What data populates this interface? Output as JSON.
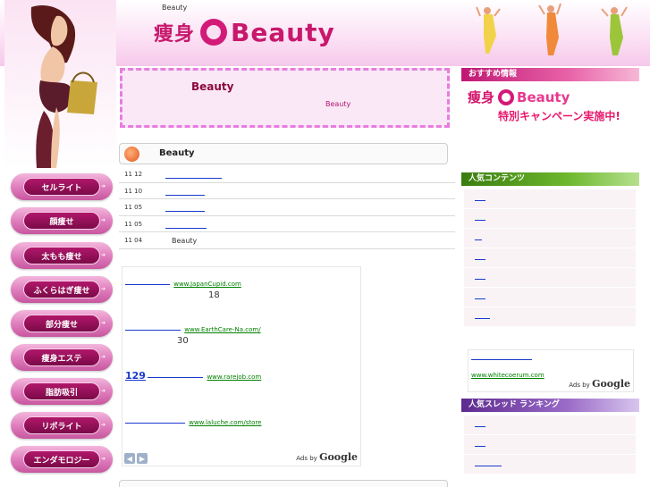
{
  "header": {
    "site_small": "Beauty",
    "logo_kanji": "痩身",
    "logo_text": "Beauty"
  },
  "notice": {
    "title": "Beauty",
    "subtitle": "Beauty"
  },
  "news": {
    "title": "Beauty",
    "rows": [
      {
        "date": "11 12",
        "text": ""
      },
      {
        "date": "11 10",
        "text": ""
      },
      {
        "date": "11 05",
        "text": ""
      },
      {
        "date": "11 05",
        "text": ""
      },
      {
        "date": "11 04",
        "text": "Beauty"
      }
    ]
  },
  "nav": {
    "items": [
      {
        "label": "セルライト"
      },
      {
        "label": "顔痩せ"
      },
      {
        "label": "太もも痩せ"
      },
      {
        "label": "ふくらはぎ痩せ"
      },
      {
        "label": "部分痩せ"
      },
      {
        "label": "痩身エステ"
      },
      {
        "label": "脂肪吸引"
      },
      {
        "label": "リポライト"
      },
      {
        "label": "エンダモロジー"
      }
    ]
  },
  "ads": {
    "items": [
      {
        "url": "www.JapanCupid.com",
        "desc": "18"
      },
      {
        "url": "www.EarthCare-Na.com/",
        "desc": "30"
      },
      {
        "big": "129",
        "url": "www.rarejob.com",
        "desc": ""
      },
      {
        "url": "www.laluche.com/store",
        "desc": ""
      }
    ],
    "adsby_prefix": "Ads by",
    "adsby_brand": "Google"
  },
  "sidebar": {
    "recommend_title": "おすすめ情報",
    "promo_logo_kanji": "痩身",
    "promo_logo_text": "Beauty",
    "promo_text": "特別キャンペーン実施中!",
    "popular_title": "人気コンテンツ",
    "thread_title": "人気スレッド ランキング",
    "ad_url": "www.whitecoerum.com",
    "ad_adsby_prefix": "Ads by",
    "ad_adsby_brand": "Google"
  },
  "colors": {
    "accent": "#c8186c",
    "link": "#1a3acc",
    "ad_url": "#008000"
  }
}
